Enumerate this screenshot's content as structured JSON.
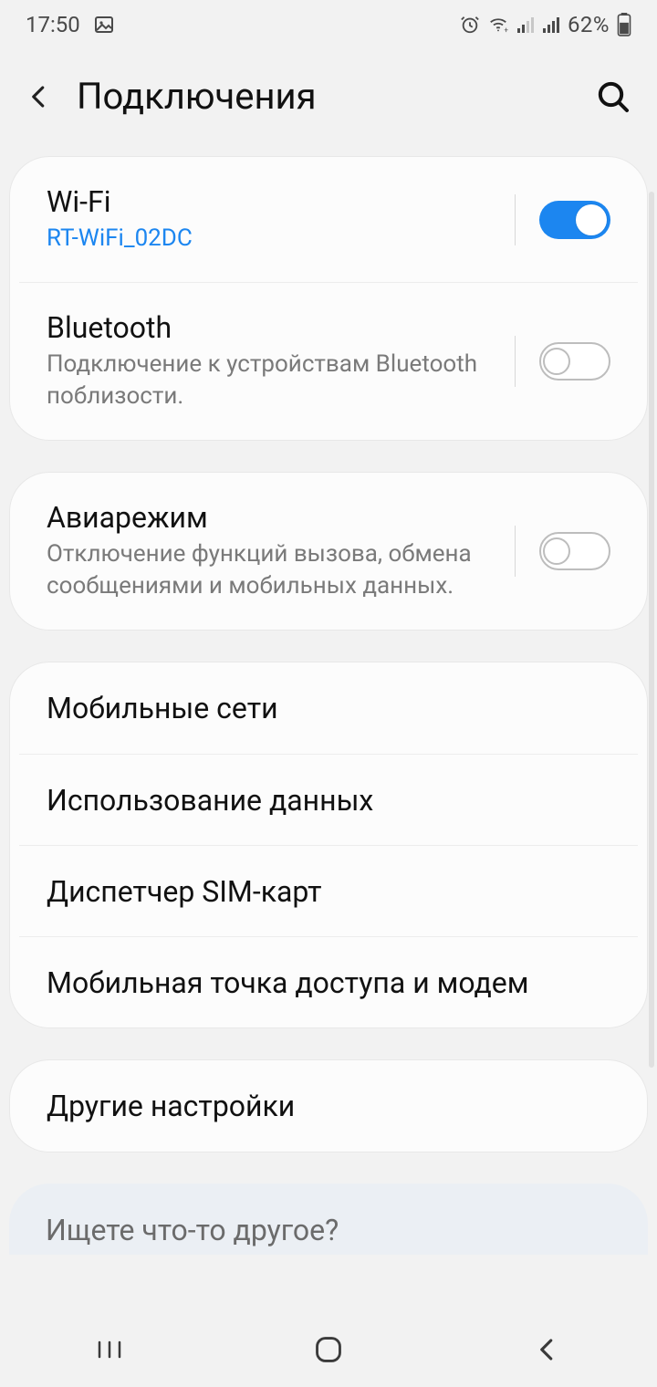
{
  "status": {
    "time": "17:50",
    "battery": "62%"
  },
  "header": {
    "title": "Подключения"
  },
  "group1": {
    "wifi": {
      "title": "Wi-Fi",
      "sub": "RT-WiFi_02DC"
    },
    "bt": {
      "title": "Bluetooth",
      "sub": "Подключение к устройствам Bluetooth поблизости."
    }
  },
  "group2": {
    "airplane": {
      "title": "Авиарежим",
      "sub": "Отключение функций вызова, обмена сообщениями и мобильных данных."
    }
  },
  "group3": {
    "mobile": {
      "title": "Мобильные сети"
    },
    "data": {
      "title": "Использование данных"
    },
    "sim": {
      "title": "Диспетчер SIM-карт"
    },
    "hotspot": {
      "title": "Мобильная точка доступа и модем"
    }
  },
  "group4": {
    "other": {
      "title": "Другие настройки"
    }
  },
  "hint": {
    "text": "Ищете что-то другое?"
  }
}
